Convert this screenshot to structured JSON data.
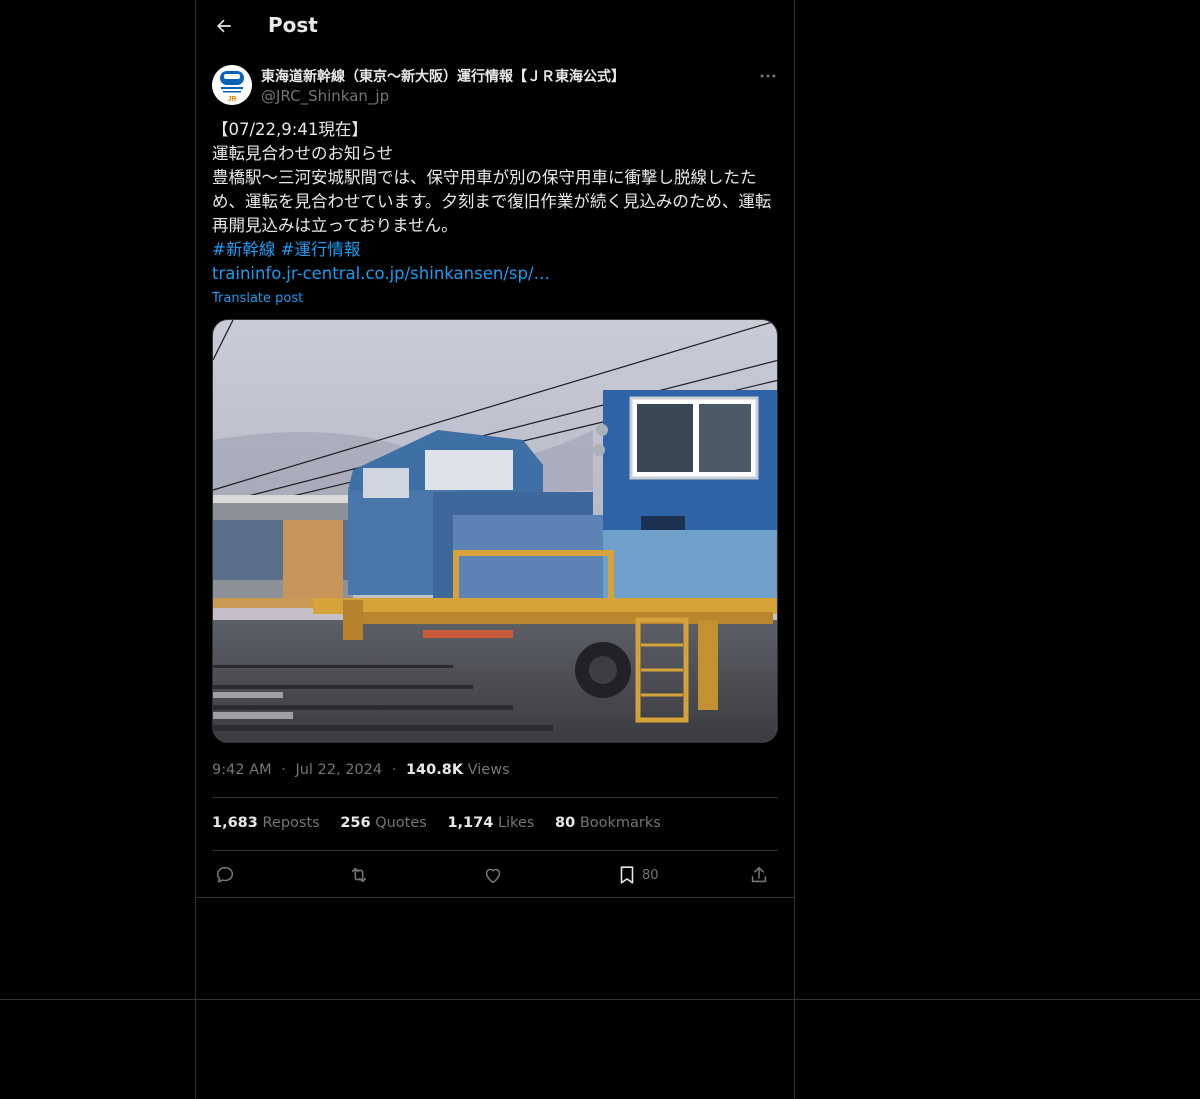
{
  "header": {
    "title": "Post",
    "back_icon": "arrow-left-icon"
  },
  "author": {
    "display_name": "東海道新幹線（東京〜新大阪）運行情報【ＪＲ東海公式】",
    "handle": "@JRC_Shinkan_jp",
    "avatar_badge": "JR"
  },
  "tweet": {
    "line1": "【07/22,9:41現在】",
    "line2": "運転見合わせのお知らせ",
    "body": "豊橋駅〜三河安城駅間では、保守用車が別の保守用車に衝撃し脱線したため、運転を見合わせています。夕刻まで復旧作業が続く見込みのため、運転再開見込みは立っておりません。",
    "hashtag1": "#新幹線",
    "hashtag2": "#運行情報",
    "url": "traininfo.jr-central.co.jp/shinkansen/sp/…",
    "translate": "Translate post"
  },
  "meta": {
    "time": "9:42 AM",
    "date": "Jul 22, 2024",
    "views_count": "140.8K",
    "views_label": "Views",
    "sep": "·"
  },
  "stats": {
    "reposts_count": "1,683",
    "reposts_label": "Reposts",
    "quotes_count": "256",
    "quotes_label": "Quotes",
    "likes_count": "1,174",
    "likes_label": "Likes",
    "bookmarks_count": "80",
    "bookmarks_label": "Bookmarks"
  },
  "actions": {
    "reply_icon": "reply-icon",
    "repost_icon": "repost-icon",
    "like_icon": "heart-icon",
    "bookmark_icon": "bookmark-icon",
    "bookmark_count": "80",
    "share_icon": "share-icon"
  },
  "colors": {
    "background": "#000000",
    "text": "#e7e9ea",
    "muted": "#71767b",
    "accent": "#1d9bf0",
    "border": "#2f3336"
  }
}
